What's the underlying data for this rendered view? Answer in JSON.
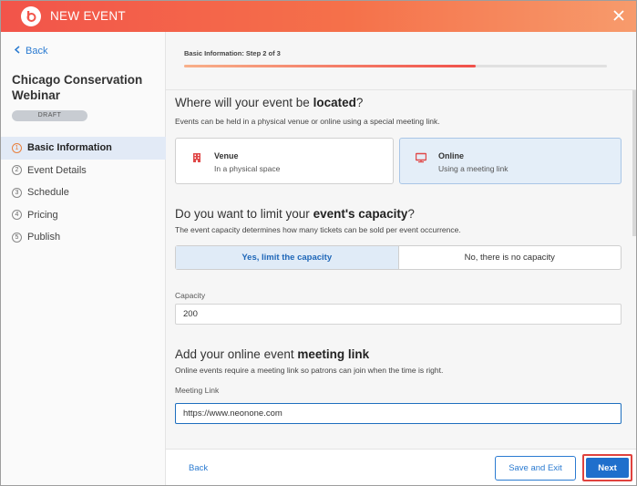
{
  "header": {
    "title": "NEW EVENT"
  },
  "sidebar": {
    "back_label": "Back",
    "event_name": "Chicago Conservation Webinar",
    "status_badge": "DRAFT",
    "steps": [
      {
        "num": "1",
        "label": "Basic Information"
      },
      {
        "num": "2",
        "label": "Event Details"
      },
      {
        "num": "3",
        "label": "Schedule"
      },
      {
        "num": "4",
        "label": "Pricing"
      },
      {
        "num": "5",
        "label": "Publish"
      }
    ]
  },
  "progress": {
    "label": "Basic Information: Step 2 of 3",
    "fraction": 0.69
  },
  "location": {
    "title_plain": "Where will your event be ",
    "title_bold": "located",
    "title_end": "?",
    "description": "Events can be held in a physical venue or online using a special meeting link.",
    "options": [
      {
        "title": "Venue",
        "subtitle": "In a physical space",
        "icon": "building-icon",
        "selected": false
      },
      {
        "title": "Online",
        "subtitle": "Using a meeting link",
        "icon": "monitor-icon",
        "selected": true
      }
    ]
  },
  "capacity": {
    "title_plain": "Do you want to limit your ",
    "title_bold": "event's capacity",
    "title_end": "?",
    "description": "The event capacity determines how many tickets can be sold per event occurrence.",
    "options": [
      "Yes, limit the capacity",
      "No, there is no capacity"
    ],
    "field_label": "Capacity",
    "value": "200"
  },
  "meeting": {
    "title_plain": "Add your online event ",
    "title_bold": "meeting link",
    "description": "Online events require a meeting link so patrons can join when the time is right.",
    "field_label": "Meeting Link",
    "value": "https://www.neonone.com"
  },
  "footer": {
    "back_label": "Back",
    "save_exit_label": "Save and Exit",
    "next_label": "Next"
  },
  "colors": {
    "accent": "#1f6fcc",
    "header_start": "#f2544a",
    "header_end": "#f79b6c",
    "highlight_border": "#e0423e"
  }
}
